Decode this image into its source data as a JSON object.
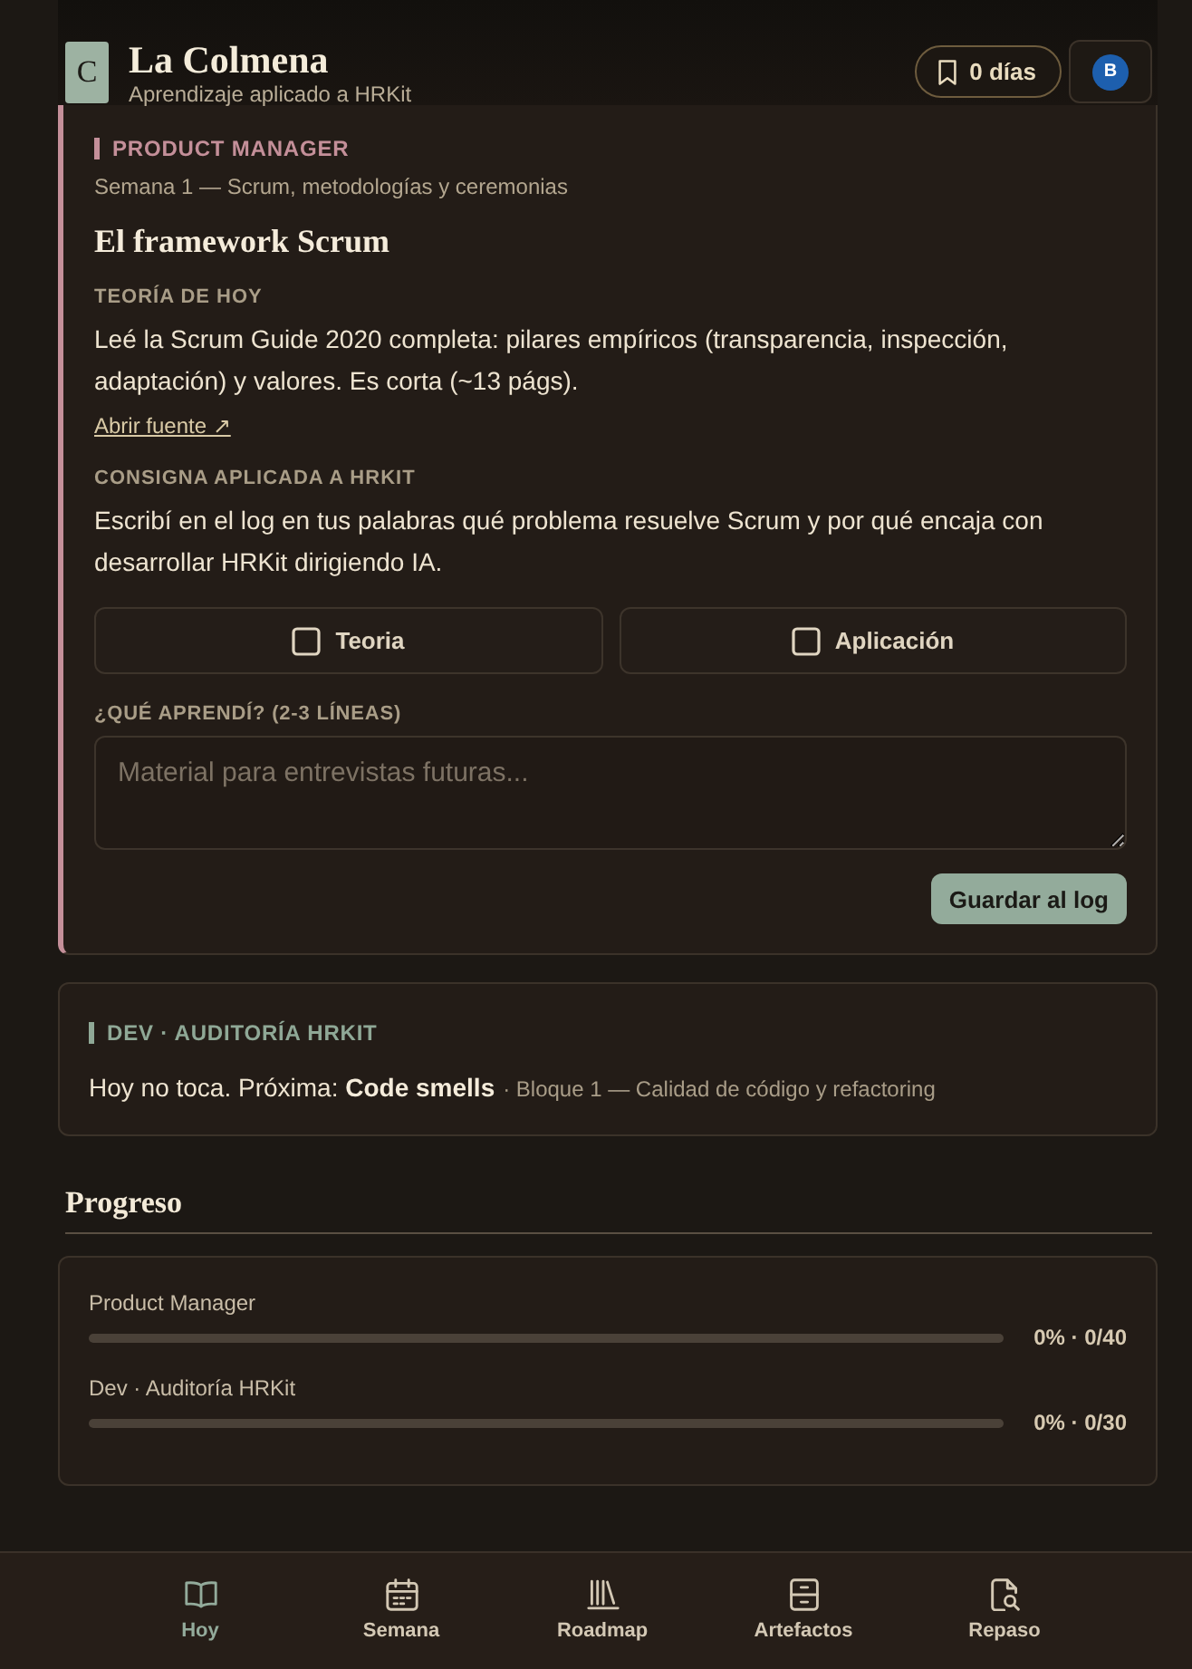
{
  "header": {
    "logo": "C",
    "title": "La Colmena",
    "subtitle": "Aprendizaje aplicado a HRKit",
    "streak": "0 días",
    "avatar": "B"
  },
  "tracks": [
    {
      "kind": "today",
      "label": "PRODUCT MANAGER",
      "color": "#c48f99",
      "week": "Semana 1 — Scrum, metodologías y ceremonias",
      "title": "El framework Scrum",
      "sections": [
        {
          "heading": "TEORÍA DE HOY",
          "text": "Leé la Scrum Guide 2020 completa: pilares empíricos (transparencia, inspección, adaptación) y valores. Es corta (~13 págs).",
          "link": "Abrir fuente ↗"
        },
        {
          "heading": "CONSIGNA APLICADA A HRKIT",
          "text": "Escribí en el log en tus palabras qué problema resuelve Scrum y por qué encaja con desarrollar HRKit dirigiendo IA."
        }
      ],
      "checks": [
        {
          "label": "Teoria",
          "checked": false
        },
        {
          "label": "Aplicación",
          "checked": false
        }
      ],
      "notes": {
        "label": "¿QUÉ APRENDÍ? (2-3 LÍNEAS)",
        "placeholder": "Material para entrevistas futuras..."
      },
      "save_button": "Guardar al log"
    },
    {
      "kind": "upcoming",
      "label": "DEV · AUDITORÍA HRKIT",
      "color": "#8fa896",
      "message": "Hoy no toca. Próxima: **Code smells**",
      "detail": "· Bloque 1 — Calidad de código y refactoring"
    }
  ],
  "progress": {
    "title": "Progreso",
    "rows": [
      {
        "name": "Product Manager",
        "level": 0,
        "reading": "0% · 0/40"
      },
      {
        "name": "Dev · Auditoría HRKit",
        "level": 0,
        "reading": "0% · 0/30"
      }
    ]
  },
  "bottom_nav": [
    {
      "label": "Hoy",
      "selected": true
    },
    {
      "label": "Semana",
      "selected": false
    },
    {
      "label": "Roadmap",
      "selected": false
    },
    {
      "label": "Artefactos",
      "selected": false
    },
    {
      "label": "Repaso",
      "selected": false
    }
  ]
}
